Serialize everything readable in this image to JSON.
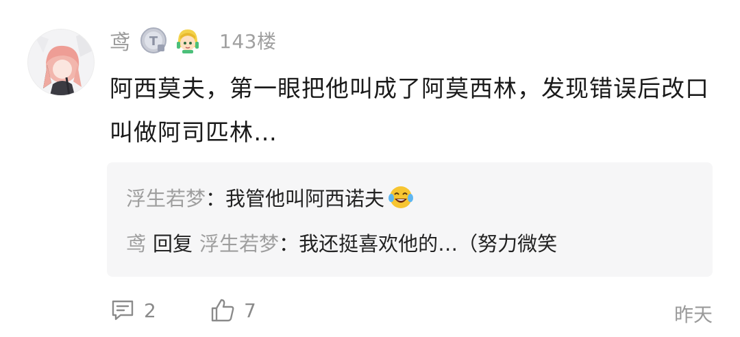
{
  "comment": {
    "username": "鸢",
    "floor": "143楼",
    "content": "阿西莫夫，第一眼把他叫成了阿莫西林，发现错误后改口叫做阿司匹林…",
    "badges": [
      "level-t-badge-icon",
      "character-badge-icon"
    ]
  },
  "replies": [
    {
      "author": "浮生若梦",
      "separator": "：",
      "text": "我管他叫阿西诺夫",
      "emoji": "laughing-tears-emoji"
    },
    {
      "author": "鸢",
      "action": "回复",
      "target": "浮生若梦",
      "separator": "：",
      "text": "我还挺喜欢他的…（努力微笑"
    }
  ],
  "footer": {
    "comment_count": "2",
    "like_count": "7",
    "time": "昨天"
  },
  "colors": {
    "username": "#9a9a9a",
    "text": "#1a1a1a",
    "reply_bg": "#f6f6f7",
    "meta": "#8a8a8a"
  }
}
